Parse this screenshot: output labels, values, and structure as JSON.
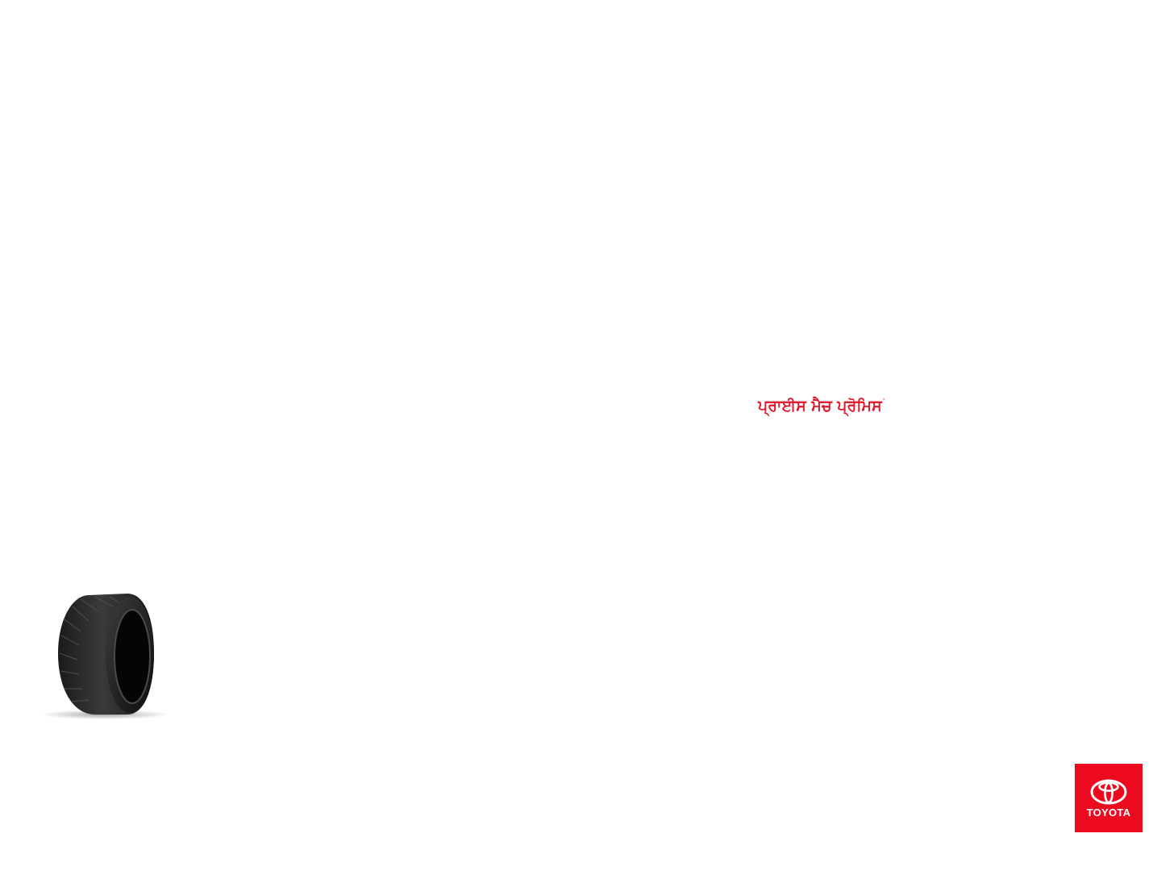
{
  "headline": {
    "text": "ਪ੍ਰਾਈਸ ਮੈਚ ਪ੍ਰੋਮਿਸ",
    "trademark": "˙",
    "color": "#e0162b"
  },
  "tire": {
    "icon": "tire-icon"
  },
  "brand": {
    "name": "TOYOTA",
    "icon": "toyota-emblem-icon",
    "background_color": "#eb0a1e",
    "text_color": "#ffffff"
  },
  "page": {
    "background_color": "#ffffff"
  }
}
